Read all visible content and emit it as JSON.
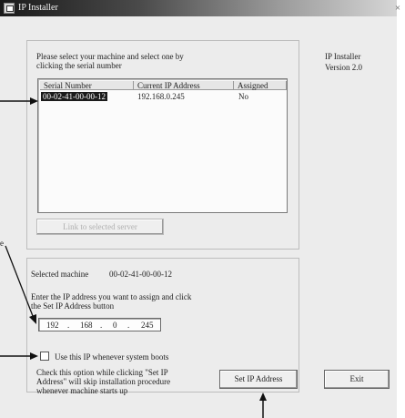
{
  "window": {
    "title": "IP Installer",
    "close_glyph": "×"
  },
  "instructions": {
    "line1": "Please select your machine and select one by",
    "line2": "clicking the serial number"
  },
  "app_info": {
    "name": "IP Installer",
    "version": "Version 2.0"
  },
  "list": {
    "columns": [
      "Serial Number",
      "Current IP Address",
      "Assigned"
    ],
    "rows": [
      {
        "serial": "00-02-41-00-00-12",
        "ip": "192.168.0.245",
        "assigned": "No"
      }
    ]
  },
  "buttons": {
    "link": "Link to selected server",
    "set_ip": "Set IP Address",
    "exit": "Exit"
  },
  "selected": {
    "label": "Selected machine",
    "serial": "00-02-41-00-00-12"
  },
  "ip_prompt": {
    "line1": "Enter the IP address you want to assign and click",
    "line2": "the Set IP Address button"
  },
  "ip_address": {
    "octet1": "192",
    "octet2": "168",
    "octet3": "0",
    "octet4": "245",
    "separator": "."
  },
  "checkbox": {
    "label": "Use this IP whenever system boots",
    "checked": false
  },
  "hint": {
    "line1": "Check this option while clicking \"Set IP",
    "line2": "Address\" will skip installation procedure",
    "line3": "whenever machine starts up"
  },
  "annotations": {
    "side_label": "e"
  }
}
